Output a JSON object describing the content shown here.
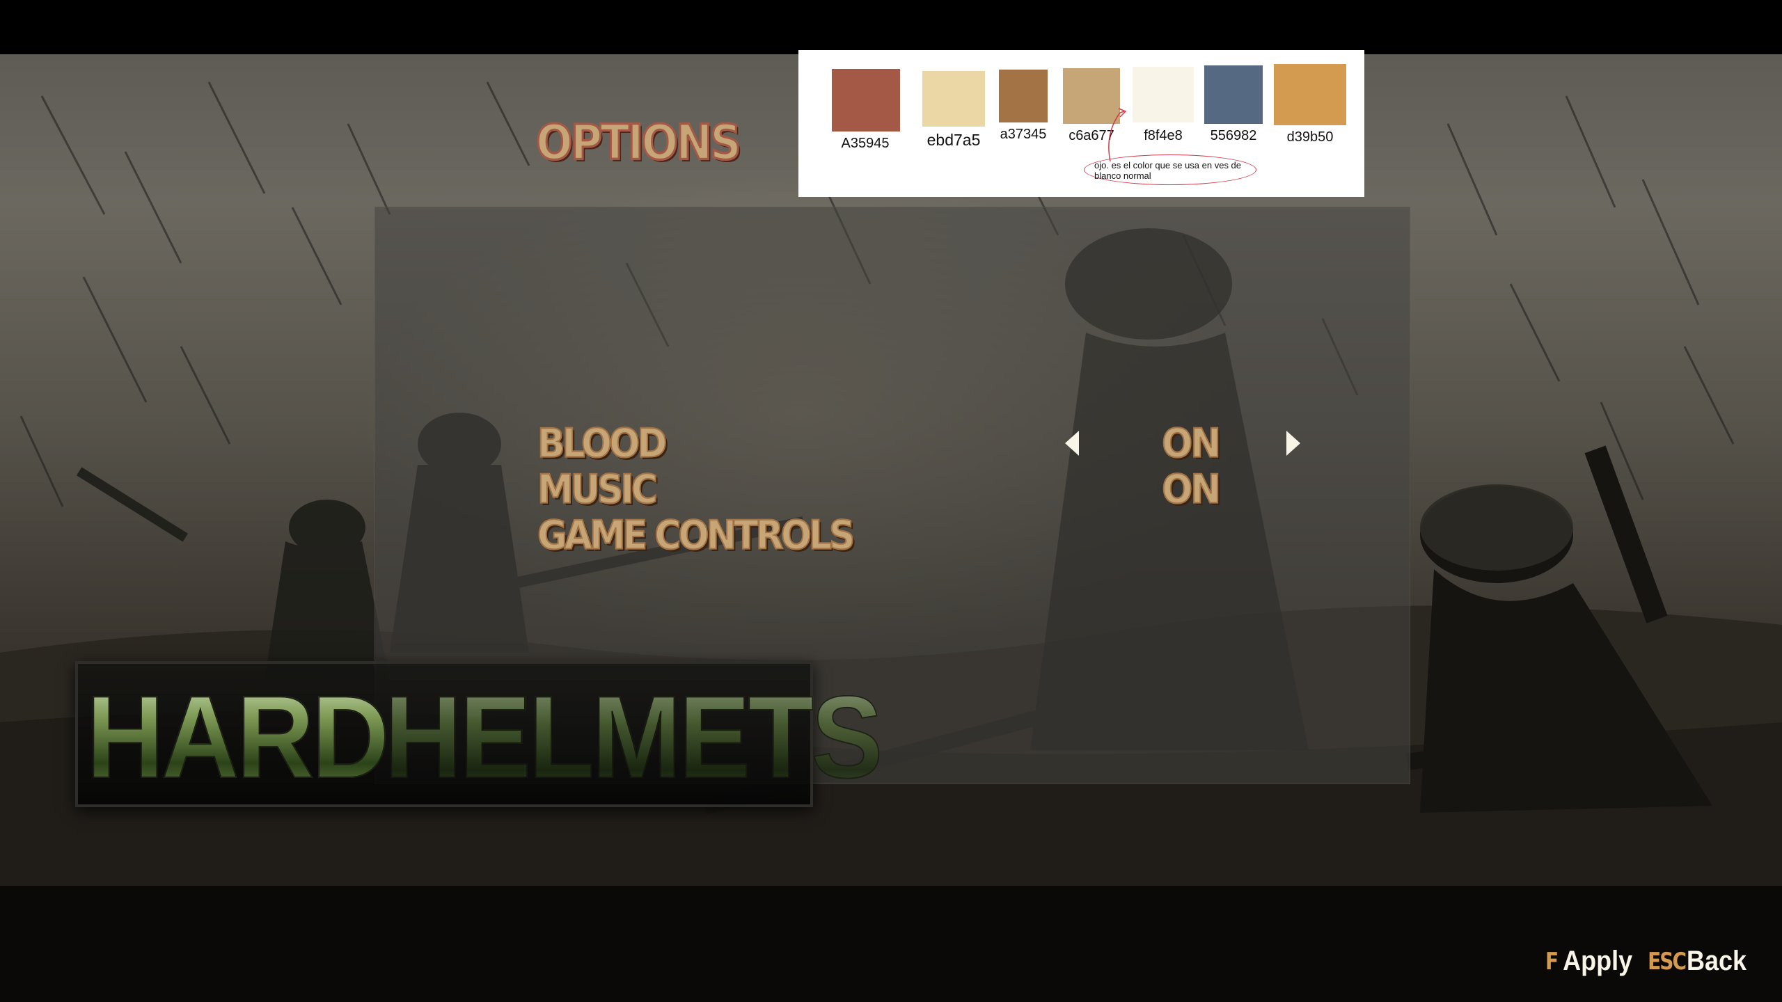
{
  "screen": {
    "title": "OPTIONS"
  },
  "menu": {
    "items": [
      {
        "label": "BLOOD",
        "value": "ON",
        "selected": true
      },
      {
        "label": "MUSIC",
        "value": "ON",
        "selected": false
      },
      {
        "label": "GAME CONTROLS",
        "value": null,
        "selected": false
      }
    ]
  },
  "logo": {
    "word1": "HARD",
    "word2": "HELMETS"
  },
  "palette": {
    "swatches": [
      {
        "hex": "#a35945",
        "label": "A35945"
      },
      {
        "hex": "#ebd7a5",
        "label": "ebd7a5"
      },
      {
        "hex": "#a37345",
        "label": "a37345"
      },
      {
        "hex": "#c6a677",
        "label": "c6a677"
      },
      {
        "hex": "#f8f4e8",
        "label": "f8f4e8"
      },
      {
        "hex": "#556982",
        "label": "556982"
      },
      {
        "hex": "#d39b50",
        "label": "d39b50"
      }
    ],
    "note": "ojo. es el color que se usa en ves de blanco normal"
  },
  "footer": {
    "apply_key": "F",
    "apply_label": "Apply",
    "back_key": "ESC",
    "back_label": "Back"
  },
  "icons": {
    "left_arrow": "arrow-left-icon",
    "right_arrow": "arrow-right-icon"
  },
  "colors": {
    "menu_text": "#c6a677",
    "menu_outline": "#a37345",
    "title_outline": "#a35945",
    "arrow": "#f8f4e8",
    "key_hint": "#d39b50"
  }
}
